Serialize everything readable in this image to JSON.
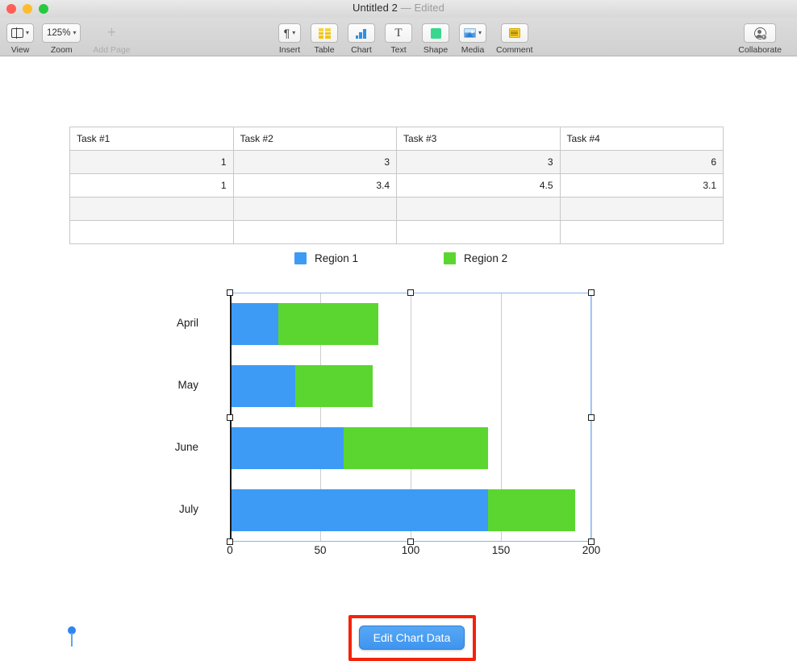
{
  "window": {
    "title": "Untitled 2",
    "separator": "—",
    "state": "Edited",
    "traffic_lights": [
      "close-button",
      "minimize-button",
      "zoom-button"
    ]
  },
  "toolbar": {
    "left_items": [
      {
        "label": "View",
        "icon": "view-icon",
        "has_chevron": true,
        "enabled": true
      },
      {
        "label": "Zoom",
        "icon": "zoom-value",
        "value": "125%",
        "has_chevron": true,
        "enabled": true
      },
      {
        "label": "Add Page",
        "icon": "plus-icon",
        "has_chevron": false,
        "enabled": false
      }
    ],
    "center_items": [
      {
        "label": "Insert",
        "icon": "paragraph-icon",
        "has_chevron": true
      },
      {
        "label": "Table",
        "icon": "table-icon",
        "has_chevron": false
      },
      {
        "label": "Chart",
        "icon": "chart-icon",
        "has_chevron": false
      },
      {
        "label": "Text",
        "icon": "text-icon",
        "has_chevron": false
      },
      {
        "label": "Shape",
        "icon": "shape-icon",
        "has_chevron": false
      },
      {
        "label": "Media",
        "icon": "media-icon",
        "has_chevron": true
      },
      {
        "label": "Comment",
        "icon": "comment-icon",
        "has_chevron": false
      }
    ],
    "right_items": [
      {
        "label": "Collaborate",
        "icon": "collaborate-icon",
        "badge": "+"
      }
    ]
  },
  "document": {
    "table": {
      "columns": [
        "Task #1",
        "Task #2",
        "Task #3",
        "Task #4"
      ],
      "rows": [
        [
          "1",
          "3",
          "3",
          "6"
        ],
        [
          "1",
          "3.4",
          "4.5",
          "3.1"
        ],
        [
          "",
          "",
          "",
          ""
        ],
        [
          "",
          "",
          "",
          ""
        ]
      ]
    },
    "edit_chart_data_button": "Edit Chart Data",
    "annotation": {
      "type": "red-rectangle-highlight",
      "color": "#f52208"
    },
    "pin_marker": {
      "name": "blue-pin-marker",
      "color": "#2f86f0"
    }
  },
  "chart_data": {
    "type": "bar",
    "orientation": "horizontal",
    "stacked": true,
    "title": "",
    "xlabel": "",
    "ylabel": "",
    "categories": [
      "April",
      "May",
      "June",
      "July"
    ],
    "series": [
      {
        "name": "Region 1",
        "color": "#3d9bf5",
        "values": [
          27,
          36,
          63,
          143
        ]
      },
      {
        "name": "Region 2",
        "color": "#5bd630",
        "values": [
          55,
          43,
          80,
          48
        ]
      }
    ],
    "totals": [
      82,
      79,
      143,
      191
    ],
    "xlim": [
      0,
      200
    ],
    "xticks": [
      0,
      50,
      100,
      150,
      200
    ],
    "xtick_labels": [
      "0",
      "50",
      "100",
      "150",
      "200"
    ],
    "grid": "vertical",
    "legend": {
      "position": "top",
      "entries": [
        "Region 1",
        "Region 2"
      ]
    },
    "selected": true
  }
}
